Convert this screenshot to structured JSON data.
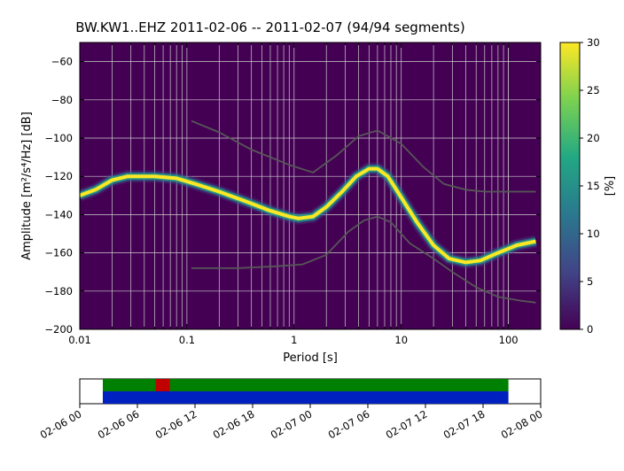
{
  "chart_data": {
    "type": "heatmap",
    "title": "BW.KW1..EHZ   2011-02-06 -- 2011-02-07  (94/94 segments)",
    "xlabel": "Period [s]",
    "ylabel": "Amplitude [m²/s⁴/Hz] [dB]",
    "cblabel": "[%]",
    "ylim": [
      -200,
      -50
    ],
    "y_ticks": [
      -60,
      -80,
      -100,
      -120,
      -140,
      -160,
      -180,
      -200
    ],
    "x_major_ticks": [
      0.01,
      0.1,
      1,
      10,
      100
    ],
    "xlim": [
      0.01,
      200
    ],
    "cb_ticks": [
      0,
      5,
      10,
      15,
      20,
      25,
      30
    ],
    "ridge_xy": [
      [
        0.01,
        -130
      ],
      [
        0.014,
        -127
      ],
      [
        0.02,
        -122
      ],
      [
        0.028,
        -120
      ],
      [
        0.05,
        -120
      ],
      [
        0.08,
        -121
      ],
      [
        0.12,
        -124
      ],
      [
        0.2,
        -128
      ],
      [
        0.35,
        -133
      ],
      [
        0.6,
        -138
      ],
      [
        0.9,
        -141
      ],
      [
        1.1,
        -142
      ],
      [
        1.5,
        -141
      ],
      [
        2.0,
        -136
      ],
      [
        2.8,
        -128
      ],
      [
        3.8,
        -120
      ],
      [
        5.0,
        -116
      ],
      [
        6.0,
        -116
      ],
      [
        7.5,
        -120
      ],
      [
        10,
        -131
      ],
      [
        14,
        -144
      ],
      [
        20,
        -156
      ],
      [
        28,
        -163
      ],
      [
        40,
        -165
      ],
      [
        55,
        -164
      ],
      [
        80,
        -160
      ],
      [
        120,
        -156
      ],
      [
        180,
        -154
      ]
    ],
    "nhnm_xy": [
      [
        0.11,
        -91
      ],
      [
        0.2,
        -97
      ],
      [
        0.4,
        -106
      ],
      [
        0.9,
        -114
      ],
      [
        1.5,
        -118
      ],
      [
        2.5,
        -109
      ],
      [
        4.0,
        -99
      ],
      [
        6.0,
        -96
      ],
      [
        10,
        -103
      ],
      [
        16,
        -115
      ],
      [
        25,
        -124
      ],
      [
        40,
        -127
      ],
      [
        60,
        -128
      ],
      [
        100,
        -128
      ],
      [
        180,
        -128
      ]
    ],
    "nlnm_xy": [
      [
        0.11,
        -168
      ],
      [
        0.3,
        -168
      ],
      [
        0.7,
        -167
      ],
      [
        1.2,
        -166
      ],
      [
        2.0,
        -161
      ],
      [
        3.2,
        -149
      ],
      [
        4.5,
        -143
      ],
      [
        6.0,
        -141
      ],
      [
        8.0,
        -144
      ],
      [
        12,
        -155
      ],
      [
        20,
        -163
      ],
      [
        30,
        -170
      ],
      [
        50,
        -178
      ],
      [
        80,
        -183
      ],
      [
        130,
        -185
      ],
      [
        180,
        -186
      ]
    ],
    "cblim": [
      0,
      30
    ]
  },
  "timeline": {
    "ticks": [
      "02-06 00",
      "02-06 06",
      "02-06 12",
      "02-06 18",
      "02-07 00",
      "02-07 06",
      "02-07 12",
      "02-07 18",
      "02-08 00"
    ],
    "bars": [
      {
        "color": "#008000",
        "start": 0.05,
        "end": 0.93,
        "row": 0
      },
      {
        "color": "#c00000",
        "start": 0.165,
        "end": 0.195,
        "row": 0
      },
      {
        "color": "#0020c0",
        "start": 0.05,
        "end": 0.93,
        "row": 1
      }
    ]
  }
}
